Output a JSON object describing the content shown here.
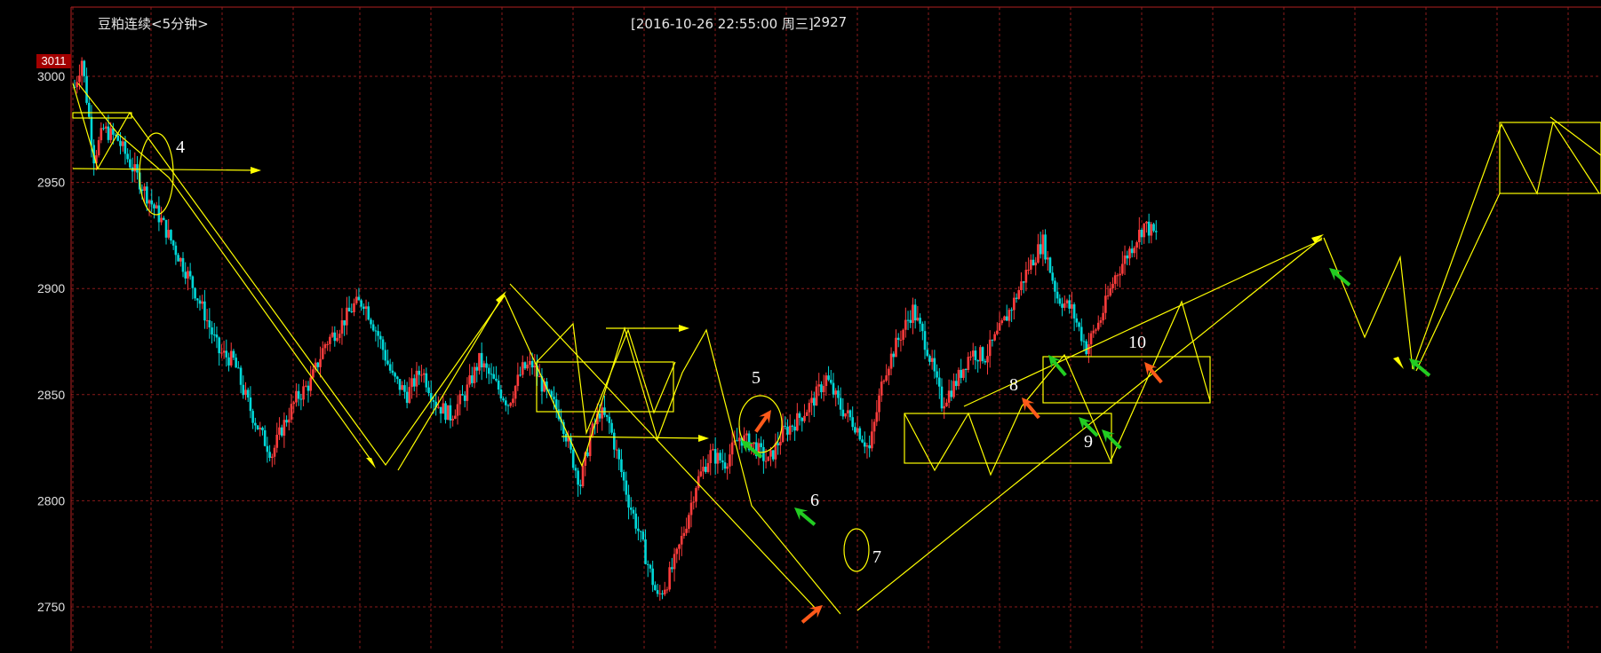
{
  "header": {
    "title": "豆粕连续<5分钟>",
    "timestamp": "[2016-10-26  22:55:00 周三]",
    "last_price": "2927"
  },
  "price_tag": "3011",
  "colors": {
    "background": "#000000",
    "grid": "#8a1a1a",
    "candle_up": "#ff3c3c",
    "candle_down": "#00d8d8",
    "trendline": "#ffff00",
    "arrow_buy": "#ff5a1a",
    "arrow_sell": "#22cc22",
    "label": "#ffffff"
  },
  "chart_data": {
    "type": "candlestick",
    "title": "豆粕连续<5分钟>",
    "yticks": [
      3000,
      2950,
      2900,
      2850,
      2800,
      2750
    ],
    "ylim": [
      2738,
      3030
    ],
    "annotations": [
      "4",
      "5",
      "6",
      "7",
      "8",
      "9",
      "10"
    ],
    "close_path": [
      [
        0,
        2995
      ],
      [
        3,
        3008
      ],
      [
        8,
        2962
      ],
      [
        12,
        2975
      ],
      [
        18,
        2970
      ],
      [
        24,
        2957
      ],
      [
        30,
        2944
      ],
      [
        36,
        2932
      ],
      [
        42,
        2918
      ],
      [
        48,
        2904
      ],
      [
        54,
        2888
      ],
      [
        60,
        2870
      ],
      [
        66,
        2866
      ],
      [
        70,
        2852
      ],
      [
        74,
        2840
      ],
      [
        78,
        2830
      ],
      [
        82,
        2822
      ],
      [
        86,
        2834
      ],
      [
        92,
        2848
      ],
      [
        98,
        2856
      ],
      [
        104,
        2874
      ],
      [
        110,
        2882
      ],
      [
        116,
        2892
      ],
      [
        120,
        2894
      ],
      [
        126,
        2878
      ],
      [
        132,
        2858
      ],
      [
        138,
        2850
      ],
      [
        144,
        2862
      ],
      [
        150,
        2846
      ],
      [
        156,
        2840
      ],
      [
        162,
        2850
      ],
      [
        168,
        2866
      ],
      [
        174,
        2856
      ],
      [
        180,
        2846
      ],
      [
        186,
        2862
      ],
      [
        190,
        2864
      ],
      [
        196,
        2850
      ],
      [
        202,
        2840
      ],
      [
        206,
        2822
      ],
      [
        210,
        2808
      ],
      [
        214,
        2830
      ],
      [
        218,
        2842
      ],
      [
        222,
        2836
      ],
      [
        226,
        2818
      ],
      [
        230,
        2800
      ],
      [
        234,
        2786
      ],
      [
        238,
        2770
      ],
      [
        242,
        2754
      ],
      [
        246,
        2762
      ],
      [
        250,
        2774
      ],
      [
        254,
        2790
      ],
      [
        258,
        2808
      ],
      [
        264,
        2822
      ],
      [
        270,
        2818
      ],
      [
        276,
        2830
      ],
      [
        282,
        2826
      ],
      [
        288,
        2818
      ],
      [
        294,
        2832
      ],
      [
        300,
        2838
      ],
      [
        306,
        2846
      ],
      [
        312,
        2858
      ],
      [
        318,
        2844
      ],
      [
        324,
        2836
      ],
      [
        330,
        2824
      ],
      [
        336,
        2860
      ],
      [
        342,
        2876
      ],
      [
        348,
        2890
      ],
      [
        354,
        2872
      ],
      [
        360,
        2846
      ],
      [
        366,
        2856
      ],
      [
        372,
        2870
      ],
      [
        378,
        2868
      ],
      [
        384,
        2880
      ],
      [
        390,
        2894
      ],
      [
        396,
        2910
      ],
      [
        402,
        2922
      ],
      [
        408,
        2896
      ],
      [
        414,
        2890
      ],
      [
        420,
        2872
      ],
      [
        426,
        2886
      ],
      [
        432,
        2906
      ],
      [
        438,
        2918
      ],
      [
        444,
        2930
      ],
      [
        450,
        2924
      ]
    ]
  }
}
